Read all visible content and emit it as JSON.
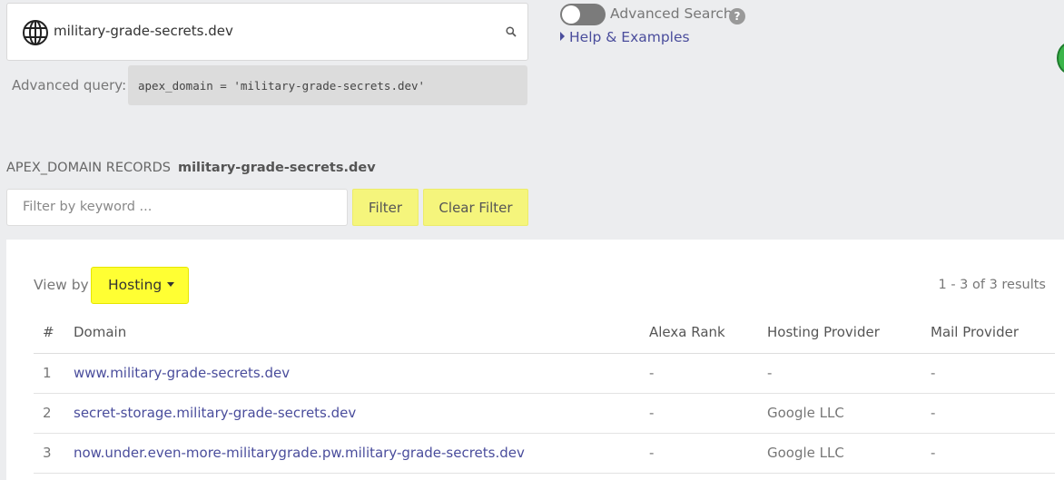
{
  "search": {
    "value": "military-grade-secrets.dev",
    "icon": "search-icon",
    "prefix_icon": "globe-icon"
  },
  "advanced_query": {
    "label": "Advanced query:",
    "code": "apex_domain = 'military-grade-secrets.dev'"
  },
  "advanced_search": {
    "label": "Advanced Search",
    "help_icon_text": "?",
    "enabled": false,
    "help_link": "Help & Examples"
  },
  "records": {
    "title_prefix": "APEX_DOMAIN RECORDS",
    "title_value": "military-grade-secrets.dev"
  },
  "filter": {
    "placeholder": "Filter by keyword ...",
    "filter_button": "Filter",
    "clear_button": "Clear Filter"
  },
  "view": {
    "label": "View by",
    "selected": "Hosting",
    "results": "1 - 3 of 3 results"
  },
  "table": {
    "headers": [
      "#",
      "Domain",
      "Alexa Rank",
      "Hosting Provider",
      "Mail Provider"
    ],
    "rows": [
      {
        "num": "1",
        "domain": "www.military-grade-secrets.dev",
        "alexa": "-",
        "hosting": "-",
        "mail": "-"
      },
      {
        "num": "2",
        "domain": "secret-storage.military-grade-secrets.dev",
        "alexa": "-",
        "hosting": "Google LLC",
        "mail": "-"
      },
      {
        "num": "3",
        "domain": "now.under.even-more-militarygrade.pw.military-grade-secrets.dev",
        "alexa": "-",
        "hosting": "Google LLC",
        "mail": "-"
      }
    ]
  },
  "colors": {
    "accent_yellow": "#ffff33",
    "button_yellow": "#f5f57c",
    "link": "#4a4d9c",
    "background": "#ecedef"
  }
}
